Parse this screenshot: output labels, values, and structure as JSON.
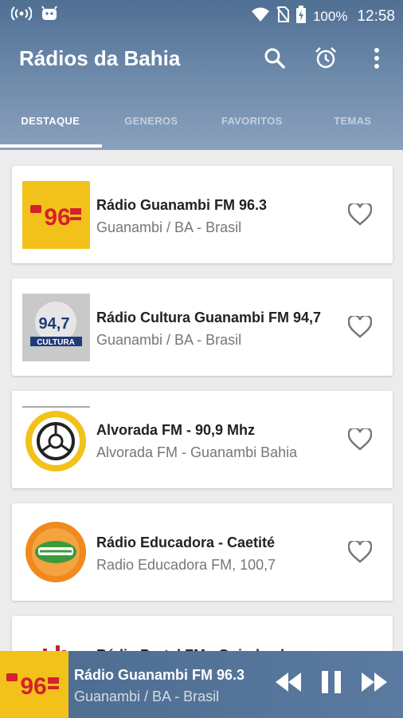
{
  "status": {
    "battery": "100%",
    "time": "12:58"
  },
  "app": {
    "title": "Rádios da Bahia"
  },
  "tabs": [
    {
      "label": "DESTAQUE"
    },
    {
      "label": "GENEROS"
    },
    {
      "label": "FAVORITOS"
    },
    {
      "label": "TEMAS"
    }
  ],
  "stations": [
    {
      "name": "Rádio Guanambi FM 96.3",
      "location": "Guanambi / BA - Brasil",
      "logo_text": "96.3"
    },
    {
      "name": "Rádio Cultura Guanambi FM 94,7",
      "location": "Guanambi / BA - Brasil",
      "logo_text": "94,7",
      "logo_subtext": "CULTURA"
    },
    {
      "name": "Alvorada FM - 90,9 Mhz",
      "location": "Alvorada FM - Guanambi Bahia"
    },
    {
      "name": "Rádio Educadora - Caetité",
      "location": "Radio Educadora FM, 100,7"
    },
    {
      "name": "Rádio Portal FM - Guirabacho",
      "location": ""
    }
  ],
  "player": {
    "name": "Rádio Guanambi FM 96.3",
    "location": "Guanambi / BA - Brasil"
  },
  "colors": {
    "header": "#4f6f93",
    "logo_yellow": "#f2c21b",
    "logo_red": "#d5212b",
    "accent": "#ffffff"
  }
}
